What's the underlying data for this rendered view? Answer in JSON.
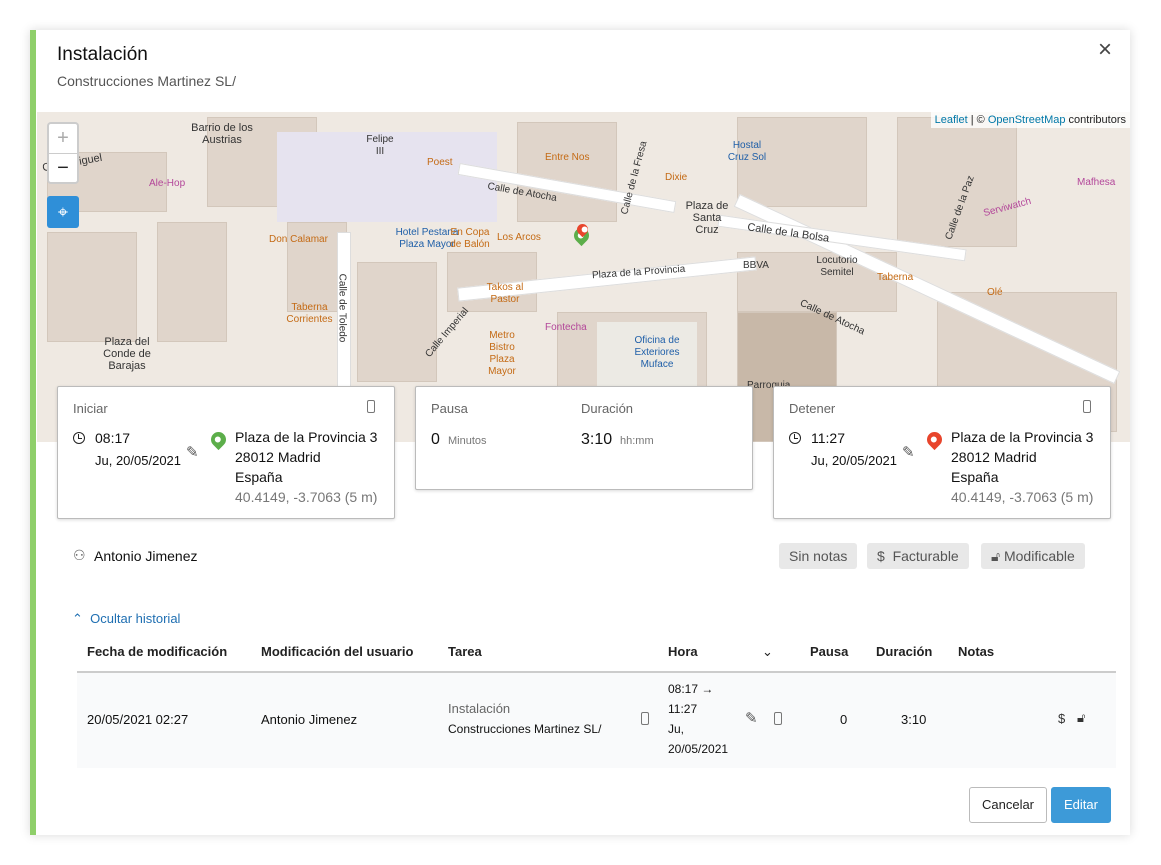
{
  "dialog": {
    "title": "Instalación",
    "subtitle": "Construcciones Martinez SL/",
    "close": "×"
  },
  "map": {
    "attribution_leaflet": "Leaflet",
    "attribution_sep": " | © ",
    "attribution_osm": "OpenStreetMap",
    "attribution_rest": " contributors",
    "zoom_in": "+",
    "zoom_out": "−",
    "labels": [
      "Calle de Atocha",
      "Plaza de la Provincia",
      "Calle de Atocha",
      "Calle de Toledo",
      "Calle Imperial",
      "Plaza del Conde de Barajas",
      "Barrio de los Austrias",
      "Plaza de Santa Cruz",
      "Calle de la Bolsa",
      "Hotel Pestana Plaza Mayor",
      "Oficina de Exteriores Muface",
      "Calle de la Fresa",
      "Calle de la Paz",
      "Calle Miguel",
      "Felipe III",
      "Poest",
      "Entre Nos",
      "Dixie",
      "Hostal Cruz Sol",
      "En Copa de Balón",
      "Los Arcos",
      "Takos al Pastor",
      "Metro Bistro Plaza Mayor",
      "Fontecha",
      "Taberna Corrientes",
      "Don Calamar",
      "Ale-Hop",
      "BBVA",
      "Locutorio Semitel",
      "Taberna",
      "Olé",
      "Serviwatch",
      "Mafhesa",
      "Parroquia"
    ]
  },
  "start": {
    "label": "Iniciar",
    "time": "08:17",
    "date": "Ju, 20/05/2021",
    "address1": "Plaza de la Provincia 3",
    "address2": "28012 Madrid",
    "country": "España",
    "coords": "40.4149, -3.7063 (5 m)",
    "pin_color": "#5cae4a"
  },
  "pause": {
    "label": "Pausa",
    "value": "0",
    "unit": "Minutos"
  },
  "duration": {
    "label": "Duración",
    "value": "3:10",
    "unit": "hh:mm"
  },
  "stop": {
    "label": "Detener",
    "time": "11:27",
    "date": "Ju, 20/05/2021",
    "address1": "Plaza de la Provincia 3",
    "address2": "28012 Madrid",
    "country": "España",
    "coords": "40.4149, -3.7063 (5 m)",
    "pin_color": "#e8452c"
  },
  "user": "Antonio Jimenez",
  "chips": {
    "notes": "Sin notas",
    "billable": "Facturable",
    "modifiable": "Modificable"
  },
  "history": {
    "toggle": "Ocultar historial",
    "headers": [
      "Fecha de modificación",
      "Modificación del usuario",
      "Tarea",
      "Hora",
      "Pausa",
      "Duración",
      "Notas"
    ],
    "row": {
      "date": "20/05/2021 02:27",
      "user": "Antonio Jimenez",
      "task": "Instalación",
      "client": "Construcciones Martinez SL/",
      "time_line1": "08:17 →",
      "time_line2": "11:27",
      "time_line3": "Ju,",
      "time_line4": "20/05/2021",
      "pause": "0",
      "duration": "3:10"
    }
  },
  "buttons": {
    "cancel": "Cancelar",
    "edit": "Editar"
  },
  "colors": {
    "accent": "#3d9ad8",
    "left_border": "#8fcf6a",
    "link": "#1f6fb2"
  }
}
